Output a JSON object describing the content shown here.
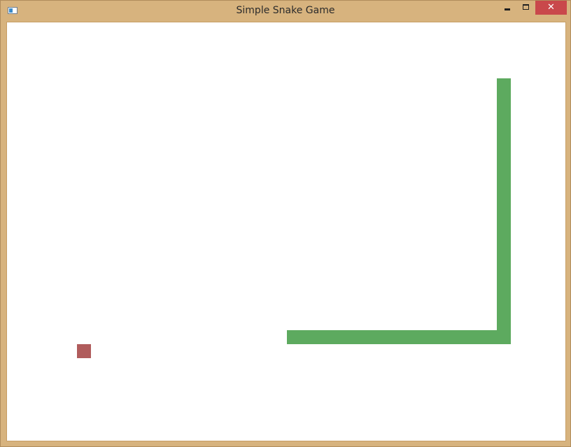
{
  "window": {
    "title": "Simple Snake Game",
    "close_glyph": "✕"
  },
  "colors": {
    "frame": "#d7b37e",
    "close_button": "#c9484b",
    "board_background": "#ffffff",
    "snake": "#5daa5f",
    "food": "#b05c5c"
  },
  "icons": {
    "app": "window-app-icon",
    "minimize": "minimize-icon",
    "maximize": "maximize-icon",
    "close": "close-icon"
  },
  "game": {
    "grid": {
      "columns": 40,
      "rows": 30
    },
    "snake": [
      [
        35,
        4
      ],
      [
        35,
        5
      ],
      [
        35,
        6
      ],
      [
        35,
        7
      ],
      [
        35,
        8
      ],
      [
        35,
        9
      ],
      [
        35,
        10
      ],
      [
        35,
        11
      ],
      [
        35,
        12
      ],
      [
        35,
        13
      ],
      [
        35,
        14
      ],
      [
        35,
        15
      ],
      [
        35,
        16
      ],
      [
        35,
        17
      ],
      [
        35,
        18
      ],
      [
        35,
        19
      ],
      [
        35,
        20
      ],
      [
        35,
        21
      ],
      [
        35,
        22
      ],
      [
        34,
        22
      ],
      [
        33,
        22
      ],
      [
        32,
        22
      ],
      [
        31,
        22
      ],
      [
        30,
        22
      ],
      [
        29,
        22
      ],
      [
        28,
        22
      ],
      [
        27,
        22
      ],
      [
        26,
        22
      ],
      [
        25,
        22
      ],
      [
        24,
        22
      ],
      [
        23,
        22
      ],
      [
        22,
        22
      ],
      [
        21,
        22
      ],
      [
        20,
        22
      ]
    ],
    "food": [
      5,
      23
    ]
  }
}
